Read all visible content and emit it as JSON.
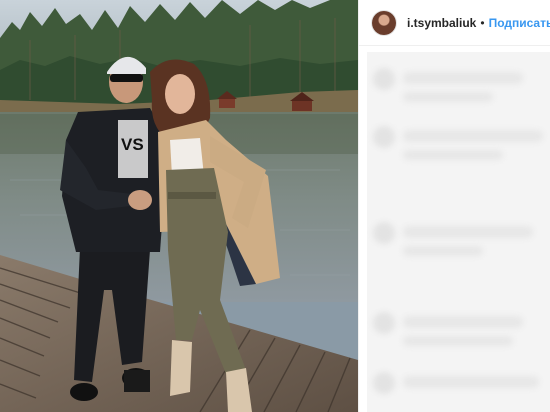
{
  "post": {
    "username": "i.tsymbaliuk",
    "separator": "•",
    "follow_label": "Подписаться"
  },
  "photo": {
    "description_icon": "photo-image"
  },
  "colors": {
    "follow_blue": "#3897f0",
    "text_dark": "#262626",
    "panel_bg": "#f4f4f4"
  }
}
